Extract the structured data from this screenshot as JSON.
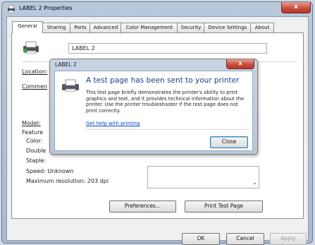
{
  "window": {
    "title": "LABEL 2 Properties",
    "close_glyph": "x"
  },
  "tabs": [
    {
      "label": "General",
      "active": true
    },
    {
      "label": "Sharing",
      "active": false
    },
    {
      "label": "Ports",
      "active": false
    },
    {
      "label": "Advanced",
      "active": false
    },
    {
      "label": "Color Management",
      "active": false
    },
    {
      "label": "Security",
      "active": false
    },
    {
      "label": "Device Settings",
      "active": false
    },
    {
      "label": "About",
      "active": false
    }
  ],
  "general": {
    "printer_name": "LABEL 2",
    "location_label": "Location:",
    "comment_label": "Commen",
    "model_label": "Model:",
    "features_label": "Feature",
    "color_label": "Color: ",
    "double_label": "Double",
    "staple_label": "Staple:",
    "speed_text": "Speed: Unknown",
    "max_resolution_text": "Maximum resolution: 203 dpi",
    "preferences_button": "Preferences...",
    "print_test_button": "Print Test Page"
  },
  "footer": {
    "ok": "OK",
    "cancel": "Cancel",
    "apply": "Apply"
  },
  "dialog": {
    "title": "LABEL 2",
    "close_glyph": "x",
    "heading": "A test page has been sent to your printer",
    "message": "This test page briefly demonstrates the printer's ability to print graphics and text, and it provides technical information about the printer. Use the printer troubleshooter if the test page does not print correctly.",
    "help_link": "Get help with printing",
    "close_button": "Close"
  },
  "colors": {
    "title_bar": "#b9c9dd",
    "close_red": "#c64a37",
    "heading_blue": "#1b3f8b",
    "link_blue": "#0645c1"
  }
}
